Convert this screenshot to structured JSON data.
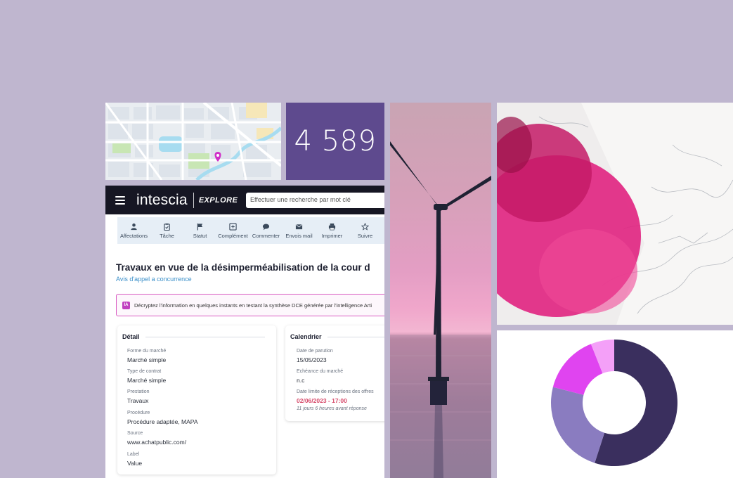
{
  "counter": {
    "value": "4 589"
  },
  "app": {
    "brand": "intescia",
    "brand_sub": "EXPLORE",
    "search_placeholder": "Effectuer une recherche par mot clé",
    "toolbar": [
      {
        "label": "Affectations",
        "icon": "person-icon"
      },
      {
        "label": "Tâche",
        "icon": "clipboard-icon"
      },
      {
        "label": "Statut",
        "icon": "flag-icon"
      },
      {
        "label": "Complément",
        "icon": "plus-square-icon"
      },
      {
        "label": "Commenter",
        "icon": "comment-icon"
      },
      {
        "label": "Envois mail",
        "icon": "mail-icon"
      },
      {
        "label": "Imprimer",
        "icon": "printer-icon"
      },
      {
        "label": "Suivre",
        "icon": "star-icon"
      }
    ],
    "title": "Travaux en vue de la désimperméabilisation de la cour d",
    "subtitle": "Avis d'appel a concurrence",
    "ai_banner": "Décryptez l'information en quelques instants en testant la synthèse DCE générée par l'intelligence Arti",
    "ai_badge": "IA",
    "detail": {
      "heading": "Détail",
      "fields": [
        {
          "label": "Forme du marché",
          "value": "Marché simple"
        },
        {
          "label": "Type de contrat",
          "value": "Marché simple"
        },
        {
          "label": "Prestation",
          "value": "Travaux"
        },
        {
          "label": "Procédure",
          "value": "Procédure adaptée, MAPA"
        },
        {
          "label": "Source",
          "value": "www.achatpublic.com/"
        },
        {
          "label": "Label",
          "value": "Value"
        }
      ]
    },
    "calendar": {
      "heading": "Calendrier",
      "fields": [
        {
          "label": "Date de parution",
          "value": "15/05/2023"
        },
        {
          "label": "Echéance du marché",
          "value": "n.c"
        },
        {
          "label": "Date limite de réceptions des offres",
          "value": "02/06/2023 - 17:00",
          "note": "11 jours 6 heures avant réponse"
        }
      ]
    }
  },
  "colors": {
    "background": "#bfb6cf",
    "header": "#161623",
    "counter_bg": "#5e4a8e",
    "accent_pink": "#d95cc2",
    "link_blue": "#3a8fc9",
    "deadline_red": "#d64a6a"
  },
  "chart_data": {
    "type": "pie",
    "values": [
      55,
      24,
      15,
      6
    ],
    "colors": [
      "#3a2f5e",
      "#8a7cc0",
      "#e044f0",
      "#f4a0f8"
    ]
  }
}
